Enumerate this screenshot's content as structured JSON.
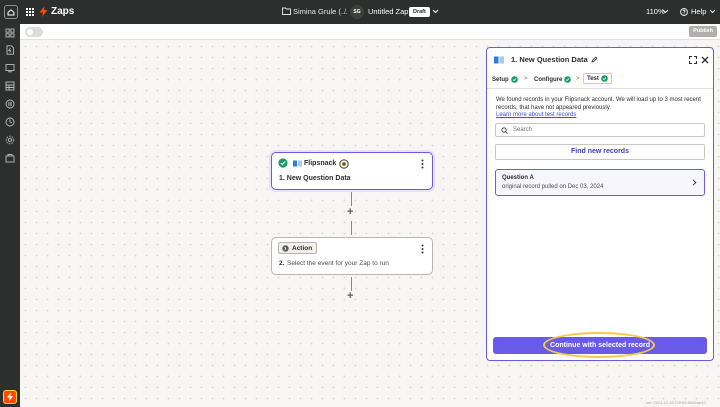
{
  "topbar": {
    "app_name": "Zaps",
    "owner": "Simina Grule (...",
    "separator": "/",
    "avatar_initials": "SG",
    "zap_name": "Untitled Zap",
    "status_badge": "Draft",
    "zoom": "110%",
    "help_label": "Help"
  },
  "subbar": {
    "publish_label": "Publish"
  },
  "canvas": {
    "trigger": {
      "app_name": "Flipsnack",
      "title": "1. New Question Data"
    },
    "action": {
      "badge_label": "Action",
      "step_number": "2.",
      "description": "Select the event for your Zap to run"
    },
    "plus_symbol": "+"
  },
  "panel": {
    "title": "1. New Question Data",
    "tabs": [
      {
        "label": "Setup"
      },
      {
        "label": "Configure"
      },
      {
        "label": "Test"
      }
    ],
    "tab_separator": ">",
    "info_text": "We found records in your Flipsnack account. We will load up to 3 most recent records, that have not appeared previously.",
    "learn_more_link": "Learn more about test records",
    "search_placeholder": "Search",
    "find_button": "Find new records",
    "record": {
      "title": "Question A",
      "subtitle": "original record pulled on Dec 03, 2024"
    },
    "continue_button": "Continue with selected record"
  },
  "version_text": "ver. 2024-12-03T09:59-80d6ae42",
  "colors": {
    "accent": "#695be8",
    "brand": "#ff4a00",
    "success": "#1d9a6c",
    "highlight": "#ffd400",
    "topbar_bg": "#2d2e2e"
  },
  "icons": {
    "top": [
      "home-icon",
      "grid-icon",
      "zap-bolt-icon",
      "folder-icon",
      "chevron-down-icon",
      "help-circle-icon"
    ],
    "sidebar": [
      "dashboard-icon",
      "zaps-icon",
      "interfaces-icon",
      "tables-icon",
      "transfers-icon",
      "history-icon",
      "settings-icon",
      "apps-icon"
    ],
    "panel": [
      "flipsnack-logo-icon",
      "edit-pencil-icon",
      "expand-icon",
      "close-icon",
      "check-circle-icon",
      "search-icon",
      "chevron-right-icon"
    ]
  }
}
